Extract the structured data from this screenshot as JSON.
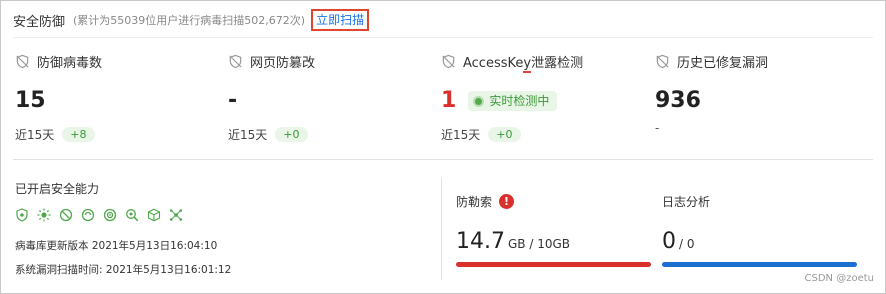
{
  "header": {
    "title": "安全防御",
    "subtitle": "(累计为55039位用户进行病毒扫描502,672次)",
    "scan_button": "立即扫描"
  },
  "stats": [
    {
      "label": "防御病毒数",
      "value": "15",
      "footer": "近15天",
      "delta": "+8",
      "icon": "shield-slash-icon"
    },
    {
      "label": "网页防篡改",
      "value": "-",
      "footer": "近15天",
      "delta": "+0",
      "icon": "shield-slash-icon"
    },
    {
      "label_prefix": "AccessKe",
      "label_highlight": "y",
      "label_suffix": "泄露检测",
      "value": "1",
      "status": "实时检测中",
      "footer": "近15天",
      "delta": "+0",
      "icon": "shield-slash-icon"
    },
    {
      "label": "历史已修复漏洞",
      "value": "936",
      "sub": "-",
      "icon": "shield-slash-icon"
    }
  ],
  "capabilities": {
    "title": "已开启安全能力",
    "icons": [
      "virus-shield-icon",
      "sun-icon",
      "no-entry-icon",
      "cycle-icon",
      "target-icon",
      "search-bug-icon",
      "cube-icon",
      "network-icon"
    ],
    "virus_db": "病毒库更新版本 2021年5月13日16:04:10",
    "vuln_scan": "系统漏洞扫描时间: 2021年5月13日16:01:12"
  },
  "ransomware": {
    "label": "防勒索",
    "used": "14.7",
    "total": "GB / 10GB",
    "usage_fraction": 1.0,
    "bar_color": "#d9302c"
  },
  "logs": {
    "label": "日志分析",
    "used": "0",
    "total": "/ 0",
    "usage_fraction": 1.0,
    "bar_color": "#1a6fd0"
  },
  "watermark": "CSDN @zoetu"
}
